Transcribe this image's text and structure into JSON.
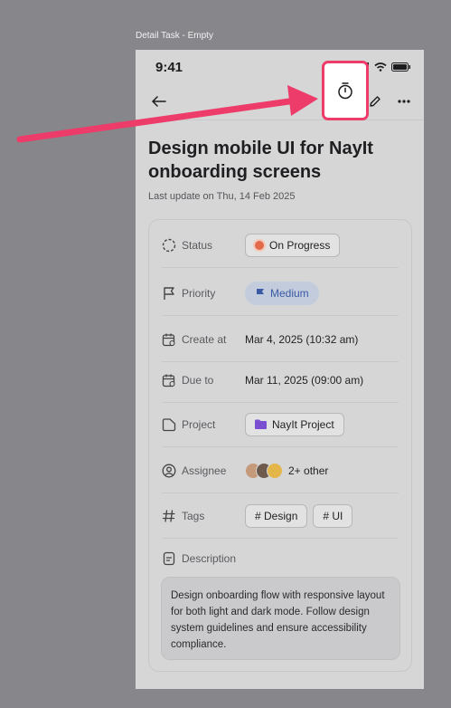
{
  "frame_label": "Detail Task - Empty",
  "status_bar": {
    "time": "9:41"
  },
  "header": {
    "back_icon": "arrow-left-icon",
    "timer_icon": "stopwatch-icon",
    "edit_icon": "pencil-icon",
    "more_icon": "ellipsis-icon"
  },
  "task": {
    "title": "Design mobile UI for NayIt onboarding screens",
    "last_update": "Last update on Thu, 14 Feb 2025"
  },
  "fields": {
    "status": {
      "label": "Status",
      "value": "On Progress"
    },
    "priority": {
      "label": "Priority",
      "value": "Medium"
    },
    "created": {
      "label": "Create at",
      "value": "Mar 4, 2025 (10:32 am)"
    },
    "due": {
      "label": "Due to",
      "value": "Mar 11, 2025 (09:00 am)"
    },
    "project": {
      "label": "Project",
      "value": "NayIt Project"
    },
    "assignee": {
      "label": "Assignee",
      "value": "2+ other"
    },
    "tags": {
      "label": "Tags",
      "items": [
        "# Design",
        "# UI"
      ]
    },
    "description": {
      "label": "Description",
      "value": "Design onboarding flow with responsive layout for both light and dark mode. Follow design system guidelines and ensure accessibility compliance."
    }
  },
  "colors": {
    "highlight": "#ee3c6a",
    "status_dot": "#e26a4a",
    "priority_text": "#3a5aa5",
    "project_folder": "#7b4fd1"
  }
}
